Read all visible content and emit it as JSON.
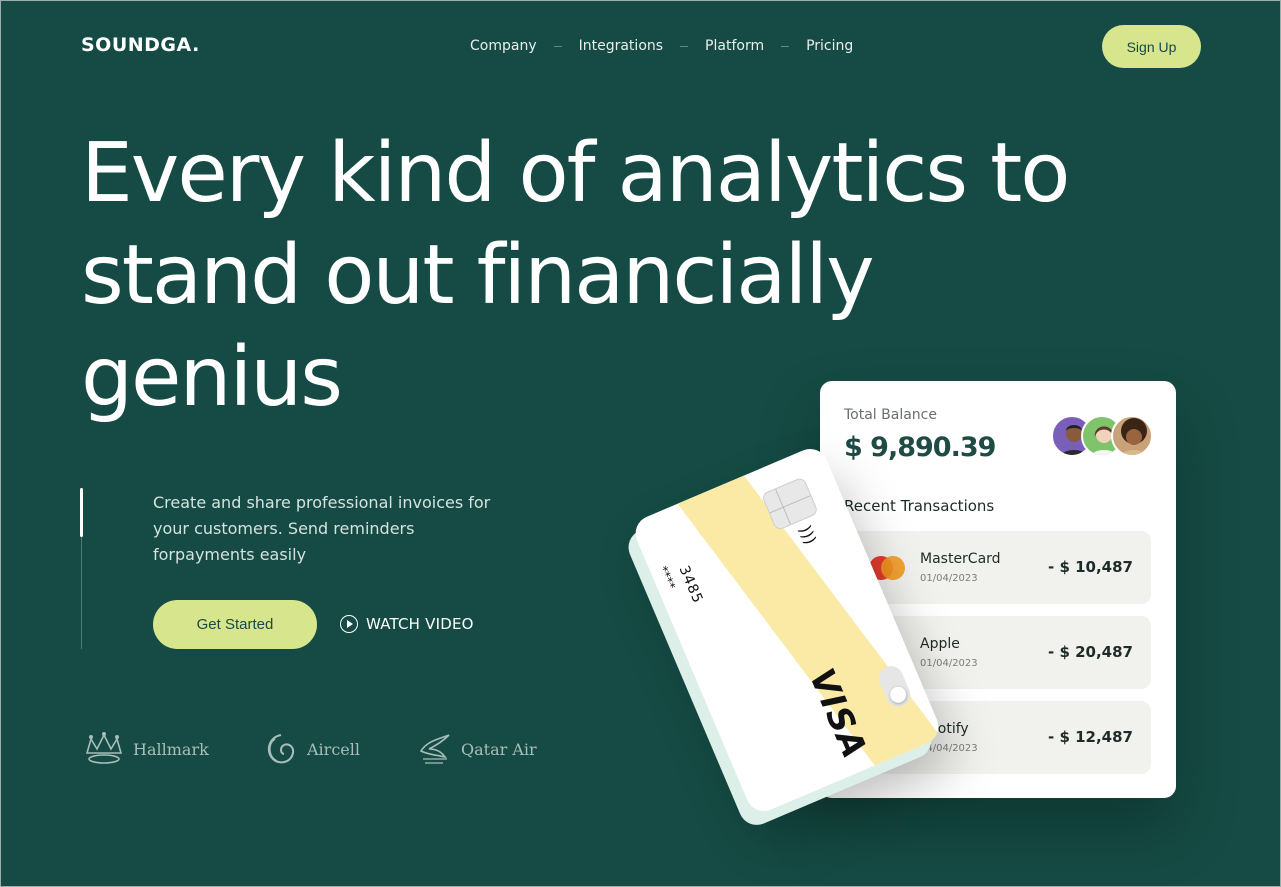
{
  "header": {
    "logo": "SOUNDGA.",
    "nav": [
      "Company",
      "Integrations",
      "Platform",
      "Pricing"
    ],
    "signup_label": "Sign Up"
  },
  "hero": {
    "headline": "Every kind of analytics to stand out financially genius",
    "description": "Create and share professional invoices for your customers. Send reminders forpayments easily",
    "cta_label": "Get Started",
    "watch_label": "WATCH VIDEO"
  },
  "brands": [
    "Hallmark",
    "Aircell",
    "Qatar Air"
  ],
  "balance_card": {
    "label": "Total Balance",
    "amount": "$ 9,890.39",
    "recent_label": "Recent Transactions",
    "transactions": [
      {
        "name": "MasterCard",
        "date": "01/04/2023",
        "amount": "- $ 10,487",
        "icon": "mastercard-icon"
      },
      {
        "name": "Apple",
        "date": "01/04/2023",
        "amount": "- $ 20,487",
        "icon": "apple-icon"
      },
      {
        "name": "Spotify",
        "date": "04/04/2023",
        "amount": "- $ 12,487",
        "icon": "spotify-icon"
      }
    ]
  },
  "visa_card": {
    "masked": "****",
    "last4": "3485",
    "brand": "VISA"
  },
  "colors": {
    "background": "#154b44",
    "accent": "#d7e58d",
    "card_stripe": "#fbe9a6"
  }
}
